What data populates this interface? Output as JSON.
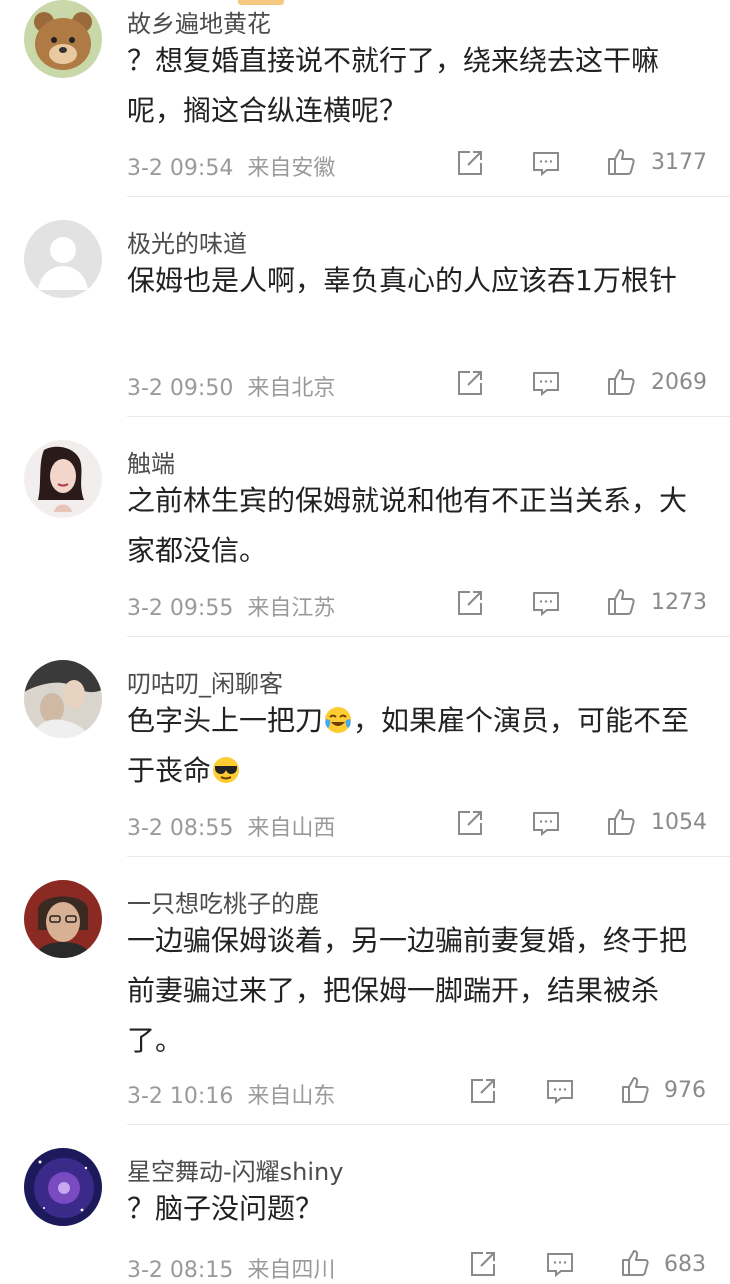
{
  "comments": [
    {
      "user": "故乡遍地黄花",
      "text": "？想复婚直接说不就行了，绕来绕去这干嘛呢，搁这合纵连横呢？",
      "time": "3-2 09:54",
      "location": "来自安徽",
      "likes": "3177",
      "avatar": "bear-avatar"
    },
    {
      "user": "极光的味道",
      "text": "保姆也是人啊，辜负真心的人应该吞1万根针",
      "time": "3-2 09:50",
      "location": "来自北京",
      "likes": "2069",
      "avatar": "default-avatar"
    },
    {
      "user": "触端",
      "text": "之前林生宾的保姆就说和他有不正当关系，大家都没信。",
      "time": "3-2 09:55",
      "location": "来自江苏",
      "likes": "1273",
      "avatar": "woman-avatar"
    },
    {
      "user": "叨咕叨_闲聊客",
      "text_a": "色字头上一把刀",
      "text_b": "，如果雇个演员，可能不至于丧命",
      "time": "3-2 08:55",
      "location": "来自山西",
      "likes": "1054",
      "avatar": "couple-photo-avatar"
    },
    {
      "user": "一只想吃桃子的鹿",
      "text": "一边骗保姆谈着，另一边骗前妻复婚，终于把前妻骗过来了，把保姆一脚踹开，结果被杀了。",
      "time": "3-2 10:16",
      "location": "来自山东",
      "likes": "976",
      "avatar": "man-avatar"
    },
    {
      "user": "星空舞动-闪耀shiny",
      "text": "？脑子没问题？",
      "time": "3-2 08:15",
      "location": "来自四川",
      "likes": "683",
      "avatar": "galaxy-avatar"
    }
  ],
  "emoji": [
    "laugh-cry-emoji",
    "sunglasses-emoji"
  ],
  "icons": [
    "repost-icon",
    "comment-icon",
    "like-icon"
  ],
  "colors": {
    "text": "#222222",
    "username": "#4d4d4d",
    "meta": "#9a9a9a",
    "divider": "#e9e9e9"
  }
}
